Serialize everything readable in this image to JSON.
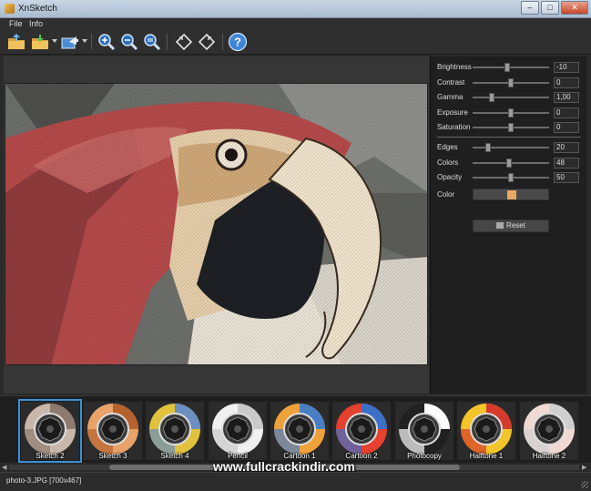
{
  "window": {
    "title": "XnSketch",
    "min": "–",
    "max": "□",
    "close": "✕"
  },
  "menu": [
    {
      "label": "File"
    },
    {
      "label": "Info"
    }
  ],
  "toolbar": {
    "icons": [
      "open-folder-icon",
      "save-folder-icon",
      "export-icon",
      "zoom-in-icon",
      "zoom-out-icon",
      "zoom-fit-icon",
      "rotate-left-icon",
      "rotate-right-icon",
      "help-icon"
    ],
    "help_glyph": "?"
  },
  "panel": {
    "params": [
      {
        "label": "Brightness",
        "value": "-10",
        "level": 0.45
      },
      {
        "label": "Contrast",
        "value": "0",
        "level": 0.5
      },
      {
        "label": "Gamma",
        "value": "1,00",
        "level": 0.25
      },
      {
        "label": "Exposure",
        "value": "0",
        "level": 0.5
      },
      {
        "label": "Saturation",
        "value": "0",
        "level": 0.5
      },
      {
        "label": "Edges",
        "value": "20",
        "level": 0.2
      },
      {
        "label": "Colors",
        "value": "48",
        "level": 0.48
      },
      {
        "label": "Opacity",
        "value": "50",
        "level": 0.5
      }
    ],
    "color_label": "Color",
    "color_value": "#e8a865",
    "reset_label": "Reset"
  },
  "presets": [
    {
      "label": "Sketch 2",
      "selected": true,
      "colors": [
        "#8f7a6e",
        "#c9b8aa"
      ]
    },
    {
      "label": "Sketch 3",
      "selected": false,
      "colors": [
        "#b5622f",
        "#e8a26a"
      ]
    },
    {
      "label": "Sketch 4",
      "selected": false,
      "colors": [
        "#6a8fc0",
        "#e1c23c"
      ]
    },
    {
      "label": "Pencil",
      "selected": false,
      "colors": [
        "#c9c9c9",
        "#f0f0f0"
      ]
    },
    {
      "label": "Cartoon 1",
      "selected": false,
      "colors": [
        "#4a7ec4",
        "#f0a23a"
      ]
    },
    {
      "label": "Cartoon 2",
      "selected": false,
      "colors": [
        "#3c6fc7",
        "#e6402e"
      ]
    },
    {
      "label": "Photocopy",
      "selected": false,
      "colors": [
        "#ffffff",
        "#202020"
      ]
    },
    {
      "label": "Halftone 1",
      "selected": false,
      "colors": [
        "#d63a2a",
        "#f4c52a"
      ]
    },
    {
      "label": "Halftone 2",
      "selected": false,
      "colors": [
        "#cfcfcf",
        "#f0d9d2"
      ]
    }
  ],
  "status": {
    "text": "photo-3.JPG [700x467]"
  },
  "watermark": "www.fullcrackindir.com"
}
